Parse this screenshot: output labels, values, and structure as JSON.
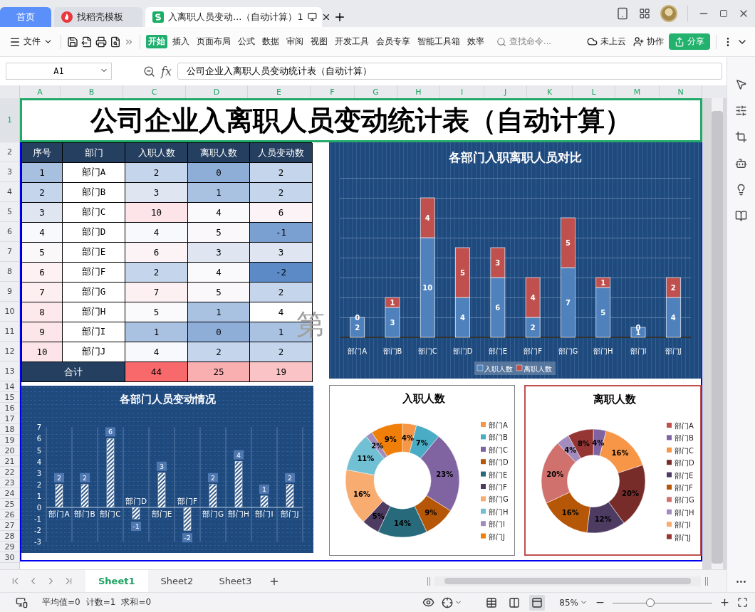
{
  "tabs": [
    {
      "label": "首页",
      "kind": "home",
      "selected": false
    },
    {
      "label": "找稻壳模板",
      "kind": "template",
      "selected": false
    },
    {
      "label": "入离职人员变动...（自动计算）1",
      "kind": "sheet",
      "selected": true
    }
  ],
  "file_menu": "文件",
  "ribbon_tabs": [
    {
      "label": "开始",
      "selected": true
    },
    {
      "label": "插入",
      "selected": false
    },
    {
      "label": "页面布局",
      "selected": false
    },
    {
      "label": "公式",
      "selected": false
    },
    {
      "label": "数据",
      "selected": false
    },
    {
      "label": "审阅",
      "selected": false
    },
    {
      "label": "视图",
      "selected": false
    },
    {
      "label": "开发工具",
      "selected": false
    },
    {
      "label": "会员专享",
      "selected": false
    },
    {
      "label": "智能工具箱",
      "selected": false
    },
    {
      "label": "效率",
      "selected": false
    }
  ],
  "search": {
    "placeholder": "查找命令..."
  },
  "cloud_status": "未上云",
  "collaborate": "协作",
  "share": "分享",
  "formula_bar": {
    "cell_ref": "A1",
    "function_label": "fx",
    "formula": "公司企业入离职人员变动统计表（自动计算）"
  },
  "columns": [
    "A",
    "B",
    "C",
    "D",
    "E",
    "F",
    "G",
    "H",
    "I",
    "J",
    "K",
    "L",
    "M",
    "N"
  ],
  "rows": [
    "1",
    "2",
    "3",
    "4",
    "5",
    "6",
    "7",
    "8",
    "9",
    "10",
    "11",
    "12",
    "13",
    "14",
    "15",
    "16",
    "17",
    "18",
    "19",
    "20",
    "21",
    "22",
    "23",
    "24",
    "25",
    "26",
    "27",
    "28",
    "29",
    "30"
  ],
  "sheet": {
    "title": {
      "text": "公司企业入离职人员变动统计表（自动计算）",
      "selected": true
    },
    "table": {
      "columns": [
        "序号",
        "部门",
        "入职人数",
        "离职人数",
        "人员变动数"
      ],
      "rows": [
        {
          "cells": [
            {
              "text": "1",
              "color": "#a7c0e0"
            },
            {
              "text": "部门A"
            },
            {
              "text": "2",
              "color": "#c5d5ec"
            },
            {
              "text": "0",
              "color": "#8eaed8"
            },
            {
              "text": "2",
              "color": "#c5d5ec"
            }
          ]
        },
        {
          "cells": [
            {
              "text": "2",
              "color": "#c5d5ec"
            },
            {
              "text": "部门B"
            },
            {
              "text": "3",
              "color": "#dfe6f2"
            },
            {
              "text": "1",
              "color": "#a9c2e2"
            },
            {
              "text": "2",
              "color": "#c5d5ec"
            }
          ]
        },
        {
          "cells": [
            {
              "text": "3",
              "color": "#dfe6f2"
            },
            {
              "text": "部门C"
            },
            {
              "text": "10",
              "color": "#fde4e8"
            },
            {
              "text": "4",
              "color": "#fafafc"
            },
            {
              "text": "6",
              "color": "#fbf3f5"
            }
          ]
        },
        {
          "cells": [
            {
              "text": "4",
              "color": "#f8f9fc"
            },
            {
              "text": "部门D"
            },
            {
              "text": "4",
              "color": "#f8f9fc"
            },
            {
              "text": "5",
              "color": "#faf8fa"
            },
            {
              "text": "-1",
              "color": "#7aa0d2"
            }
          ]
        },
        {
          "cells": [
            {
              "text": "5",
              "color": "#fbf8fa"
            },
            {
              "text": "部门E"
            },
            {
              "text": "6",
              "color": "#fbf3f5"
            },
            {
              "text": "3",
              "color": "#dfe6f2"
            },
            {
              "text": "3",
              "color": "#dfe6f2"
            }
          ]
        },
        {
          "cells": [
            {
              "text": "6",
              "color": "#fdf1f3"
            },
            {
              "text": "部门F"
            },
            {
              "text": "2",
              "color": "#c5d5ec"
            },
            {
              "text": "4",
              "color": "#fafafc"
            },
            {
              "text": "-2",
              "color": "#5b8ac6"
            }
          ]
        },
        {
          "cells": [
            {
              "text": "7",
              "color": "#fdeef0"
            },
            {
              "text": "部门G"
            },
            {
              "text": "7",
              "color": "#fcf0f2"
            },
            {
              "text": "5",
              "color": "#faf8fa"
            },
            {
              "text": "2",
              "color": "#c5d5ec"
            }
          ]
        },
        {
          "cells": [
            {
              "text": "8",
              "color": "#fde9ec"
            },
            {
              "text": "部门H"
            },
            {
              "text": "5",
              "color": "#fafafc"
            },
            {
              "text": "1",
              "color": "#a9c2e2"
            },
            {
              "text": "4",
              "color": "#ffffff"
            }
          ]
        },
        {
          "cells": [
            {
              "text": "9",
              "color": "#fce6e9"
            },
            {
              "text": "部门I"
            },
            {
              "text": "1",
              "color": "#a9c2e2"
            },
            {
              "text": "0",
              "color": "#8eaed8"
            },
            {
              "text": "1",
              "color": "#a9c2e2"
            }
          ]
        },
        {
          "cells": [
            {
              "text": "10",
              "color": "#fce4e8"
            },
            {
              "text": "部门J"
            },
            {
              "text": "4",
              "color": "#f8f9fc"
            },
            {
              "text": "2",
              "color": "#c5d5ec"
            },
            {
              "text": "2",
              "color": "#c5d5ec"
            }
          ]
        }
      ],
      "total": {
        "label": "合计",
        "cells": [
          {
            "text": "44",
            "color": "#f8696b"
          },
          {
            "text": "25",
            "color": "#f9aeb0"
          },
          {
            "text": "19",
            "color": "#fac4c6"
          }
        ]
      }
    },
    "page_label": "第",
    "charts": [
      {
        "chart_data": {
          "type": "bar",
          "title": "各部门入职离职人员对比",
          "stacked": true,
          "data_labels": true,
          "legend": true,
          "categories": [
            "部门A",
            "部门B",
            "部门C",
            "部门D",
            "部门E",
            "部门F",
            "部门G",
            "部门H",
            "部门I",
            "部门J"
          ],
          "series": [
            {
              "name": "入职人数",
              "color": "#4f81bd",
              "values": [
                2,
                3,
                10,
                4,
                6,
                2,
                7,
                5,
                1,
                4
              ]
            },
            {
              "name": "离职人数",
              "color": "#c0504d",
              "values": [
                0,
                1,
                4,
                5,
                3,
                4,
                5,
                1,
                0,
                2
              ]
            }
          ]
        }
      },
      {
        "chart_data": {
          "type": "bar",
          "title": "各部门人员变动情况",
          "stacked": false,
          "data_labels": true,
          "ylim": [
            -3,
            7
          ],
          "yticks": [
            {
              "value": -3,
              "label": "-3"
            },
            {
              "value": -2,
              "label": "-2"
            },
            {
              "value": -1,
              "label": "-1"
            },
            {
              "value": 0,
              "label": "0"
            },
            {
              "value": 1,
              "label": "1"
            },
            {
              "value": 2,
              "label": "2"
            },
            {
              "value": 3,
              "label": "3"
            },
            {
              "value": 4,
              "label": "4"
            },
            {
              "value": 5,
              "label": "5"
            },
            {
              "value": 6,
              "label": "6"
            },
            {
              "value": 7,
              "label": "7"
            }
          ],
          "categories": [
            "部门A",
            "部门B",
            "部门C",
            "部门D",
            "部门E",
            "部门F",
            "部门G",
            "部门H",
            "部门I",
            "部门J"
          ],
          "series": [
            {
              "color": "#ffffff",
              "values": [
                2,
                2,
                6,
                -1,
                3,
                -2,
                2,
                4,
                1,
                2
              ]
            }
          ]
        }
      },
      {
        "color": "#808080",
        "chart_data": {
          "type": "donut",
          "title": "入职人数",
          "legend": true,
          "categories": [
            "部门A",
            "部门B",
            "部门C",
            "部门D",
            "部门E",
            "部门F",
            "部门G",
            "部门H",
            "部门I",
            "部门J"
          ],
          "values": [
            4,
            7,
            23,
            9,
            14,
            5,
            16,
            11,
            2,
            9
          ],
          "value_labels": [
            "4%",
            "7%",
            "23%",
            "9%",
            "14%",
            "5%",
            "16%",
            "11%",
            "2%",
            "9%"
          ],
          "colors": [
            "#f79646",
            "#4bacc6",
            "#8064a2",
            "#b65708",
            "#276a7c",
            "#4d3b62",
            "#f9ac70",
            "#72c0d4",
            "#a28cbd",
            "#f07f09"
          ]
        }
      },
      {
        "color": "#c0504d",
        "chart_data": {
          "type": "donut",
          "title": "离职人数",
          "legend": true,
          "categories": [
            "部门A",
            "部门B",
            "部门C",
            "部门D",
            "部门E",
            "部门F",
            "部门G",
            "部门H",
            "部门I",
            "部门J"
          ],
          "values": [
            0,
            4,
            16,
            20,
            12,
            16,
            20,
            4,
            0,
            8
          ],
          "value_labels": [
            null,
            "4%",
            "16%",
            "20%",
            "12%",
            "16%",
            "20%",
            "4%",
            null,
            "8%"
          ],
          "colors": [
            "#c0504d",
            "#8064a2",
            "#f79646",
            "#772c2a",
            "#4d3b62",
            "#b65708",
            "#d0716e",
            "#a28cbd",
            "#f9ac70",
            "#963634"
          ]
        }
      }
    ]
  },
  "sheet_tabs": [
    {
      "label": "Sheet1",
      "selected": true
    },
    {
      "label": "Sheet2",
      "selected": false
    },
    {
      "label": "Sheet3",
      "selected": false
    }
  ],
  "status_bar": {
    "stats": [
      "平均值=0",
      "计数=1",
      "求和=0"
    ],
    "view_modes": [
      {
        "kind": "normal",
        "selected": false
      },
      {
        "kind": "reading",
        "selected": false
      },
      {
        "kind": "page_break",
        "selected": true
      }
    ],
    "zoom": "85%",
    "zoom_slider": {
      "level": 0.38
    }
  }
}
